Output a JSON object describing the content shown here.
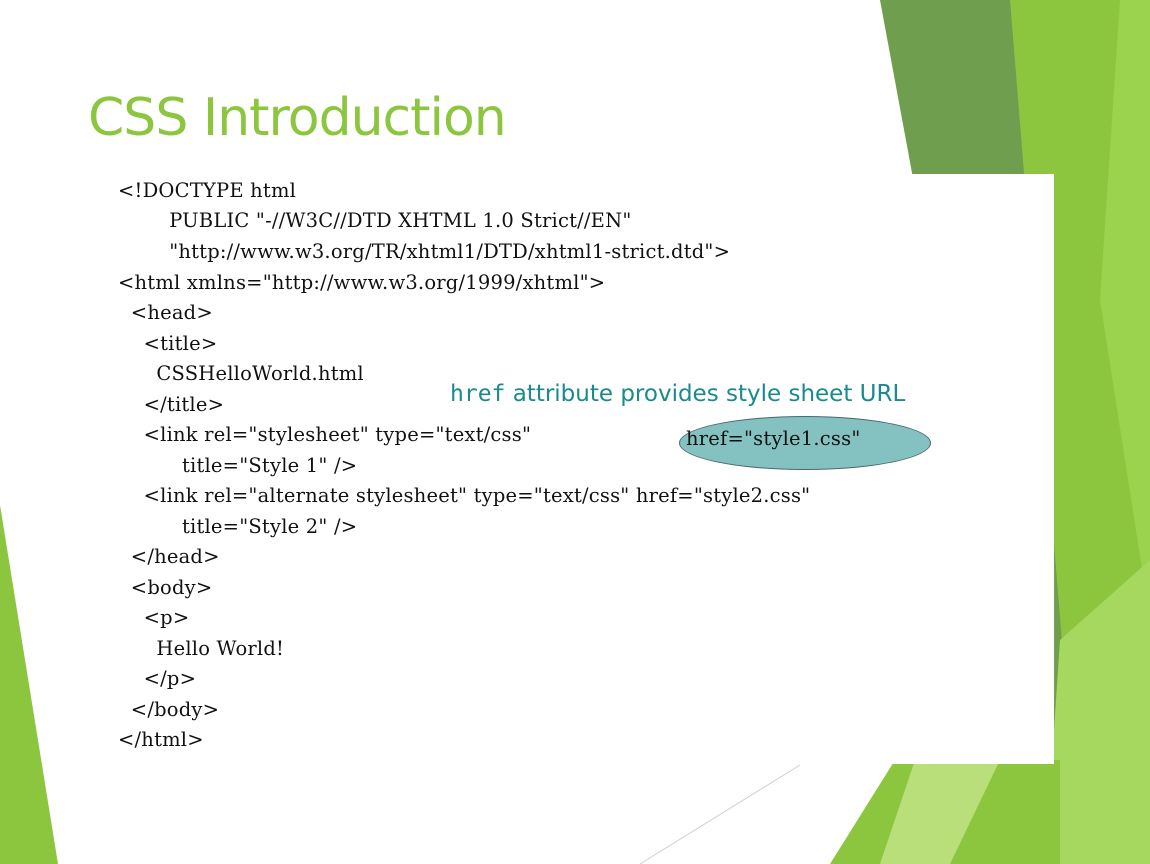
{
  "slide": {
    "title": "CSS Introduction",
    "colors": {
      "accent": "#8cc63f",
      "annotation_text": "#1a8a8a",
      "highlight_fill": "#6fb7b7",
      "highlight_stroke": "#2d4d55",
      "code_text": "#111111"
    }
  },
  "code": {
    "lines": [
      "<!DOCTYPE html",
      "        PUBLIC \"-//W3C//DTD XHTML 1.0 Strict//EN\"",
      "        \"http://www.w3.org/TR/xhtml1/DTD/xhtml1-strict.dtd\">",
      "<html xmlns=\"http://www.w3.org/1999/xhtml\">",
      "  <head>",
      "    <title>",
      "      CSSHelloWorld.html",
      "    </title>",
      "    <link rel=\"stylesheet\" type=\"text/css\" ",
      "          title=\"Style 1\" />",
      "    <link rel=\"alternate stylesheet\" type=\"text/css\" href=\"style2.css\"",
      "          title=\"Style 2\" />",
      "  </head>",
      "  <body>",
      "    <p>",
      "      Hello World!",
      "    </p>",
      "  </body>",
      "</html>"
    ],
    "highlighted_fragment": "href=\"style1.css\""
  },
  "annotation": {
    "code_word": "href",
    "text": " attribute provides style sheet URL"
  }
}
